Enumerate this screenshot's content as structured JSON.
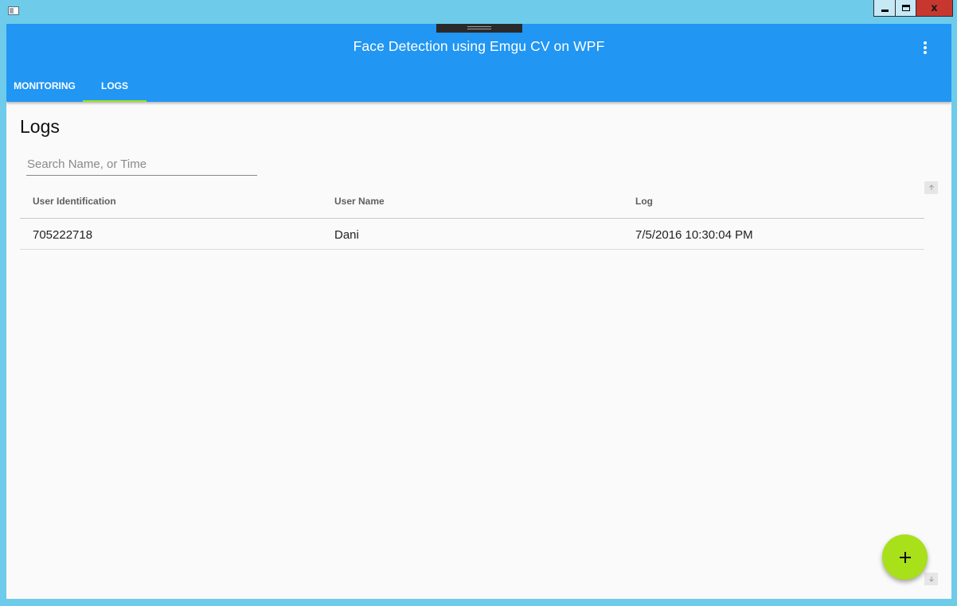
{
  "window": {
    "close_glyph": "x",
    "icons": [
      "app-icon",
      "minimize-icon",
      "maximize-icon",
      "close-icon"
    ]
  },
  "app": {
    "title": "Face Detection using Emgu CV on WPF",
    "more_icon": "more-vertical-icon"
  },
  "tabs": [
    {
      "label": "MONITORING",
      "active": false
    },
    {
      "label": "LOGS",
      "active": true
    }
  ],
  "accent_colors": {
    "primary": "#2196f3",
    "accent": "#9ee01c",
    "fab": "#a8e01a",
    "window_frame": "#6ecbea",
    "close_button": "#c7372e"
  },
  "logs": {
    "page_title": "Logs",
    "search": {
      "placeholder": "Search Name, or Time",
      "value": ""
    },
    "columns": [
      "User Identification",
      "User Name",
      "Log"
    ],
    "rows": [
      [
        "705222718",
        "Dani",
        "7/5/2016 10:30:04 PM"
      ]
    ]
  },
  "fab": {
    "icon": "plus-icon"
  },
  "scrollbar": {
    "up_icon": "arrow-up-icon",
    "down_icon": "arrow-down-icon"
  }
}
